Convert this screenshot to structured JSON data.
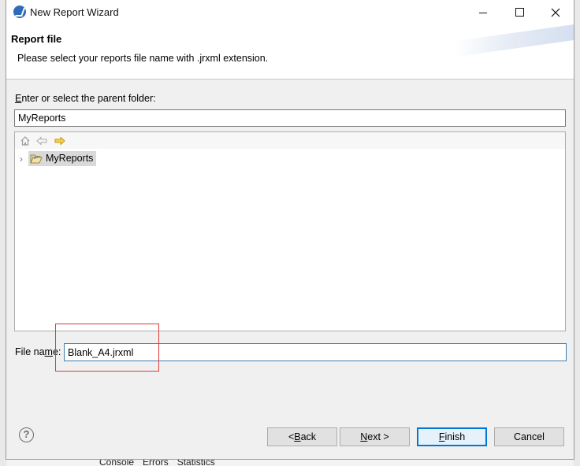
{
  "window": {
    "title": "New Report Wizard"
  },
  "banner": {
    "title": "Report file",
    "description": "Please select your reports file name with .jrxml extension."
  },
  "parent_folder": {
    "label_first": "E",
    "label_rest": "nter or select the parent folder:",
    "value": "MyReports"
  },
  "tree": {
    "toolbar": [
      "home-icon",
      "back-arrow-icon",
      "forward-arrow-icon"
    ],
    "items": [
      {
        "label": "MyReports",
        "expanded": false,
        "selected": true
      }
    ]
  },
  "file_name": {
    "label_pre": "File na",
    "label_accel": "m",
    "label_post": "e:",
    "value": "Blank_A4.jrxml"
  },
  "buttons": {
    "back_pre": "< ",
    "back_accel": "B",
    "back_post": "ack",
    "next_accel": "N",
    "next_post": "ext >",
    "finish_accel": "F",
    "finish_post": "inish",
    "cancel": "Cancel"
  },
  "background_tabs": [
    "Console",
    "Errors",
    "Statistics"
  ],
  "colors": {
    "accent": "#0078d7",
    "highlight_box": "#e03a3a"
  }
}
